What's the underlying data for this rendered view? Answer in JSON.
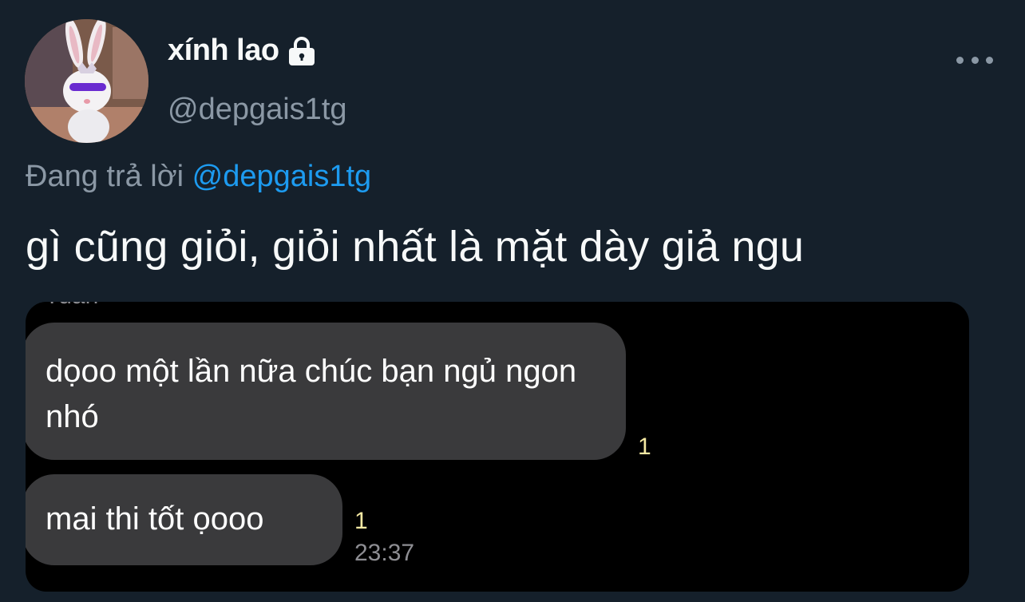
{
  "tweet": {
    "display_name": "xính lao",
    "handle": "@depgais1tg",
    "replying_label": "Đang trả lời",
    "replying_mention": "@depgais1tg",
    "text": "gì cũng giỏi, giỏi nhất là mặt dày giả ngu"
  },
  "icons": {
    "lock": "lock-icon",
    "more": "more-icon",
    "avatar": "avatar"
  },
  "media": {
    "cut_sender": "Tuấn",
    "messages": [
      {
        "text": "dọoo một lần nữa chúc bạn ngủ ngon nhó",
        "read_count": "1"
      },
      {
        "text": "mai thi tốt ọooo",
        "read_count": "1",
        "time": "23:37"
      }
    ]
  },
  "colors": {
    "background": "#15202b",
    "mention": "#1d9bf0",
    "secondary_text": "#8b98a5",
    "bubble": "#3a3a3c",
    "read_count": "#f5e9a3"
  }
}
